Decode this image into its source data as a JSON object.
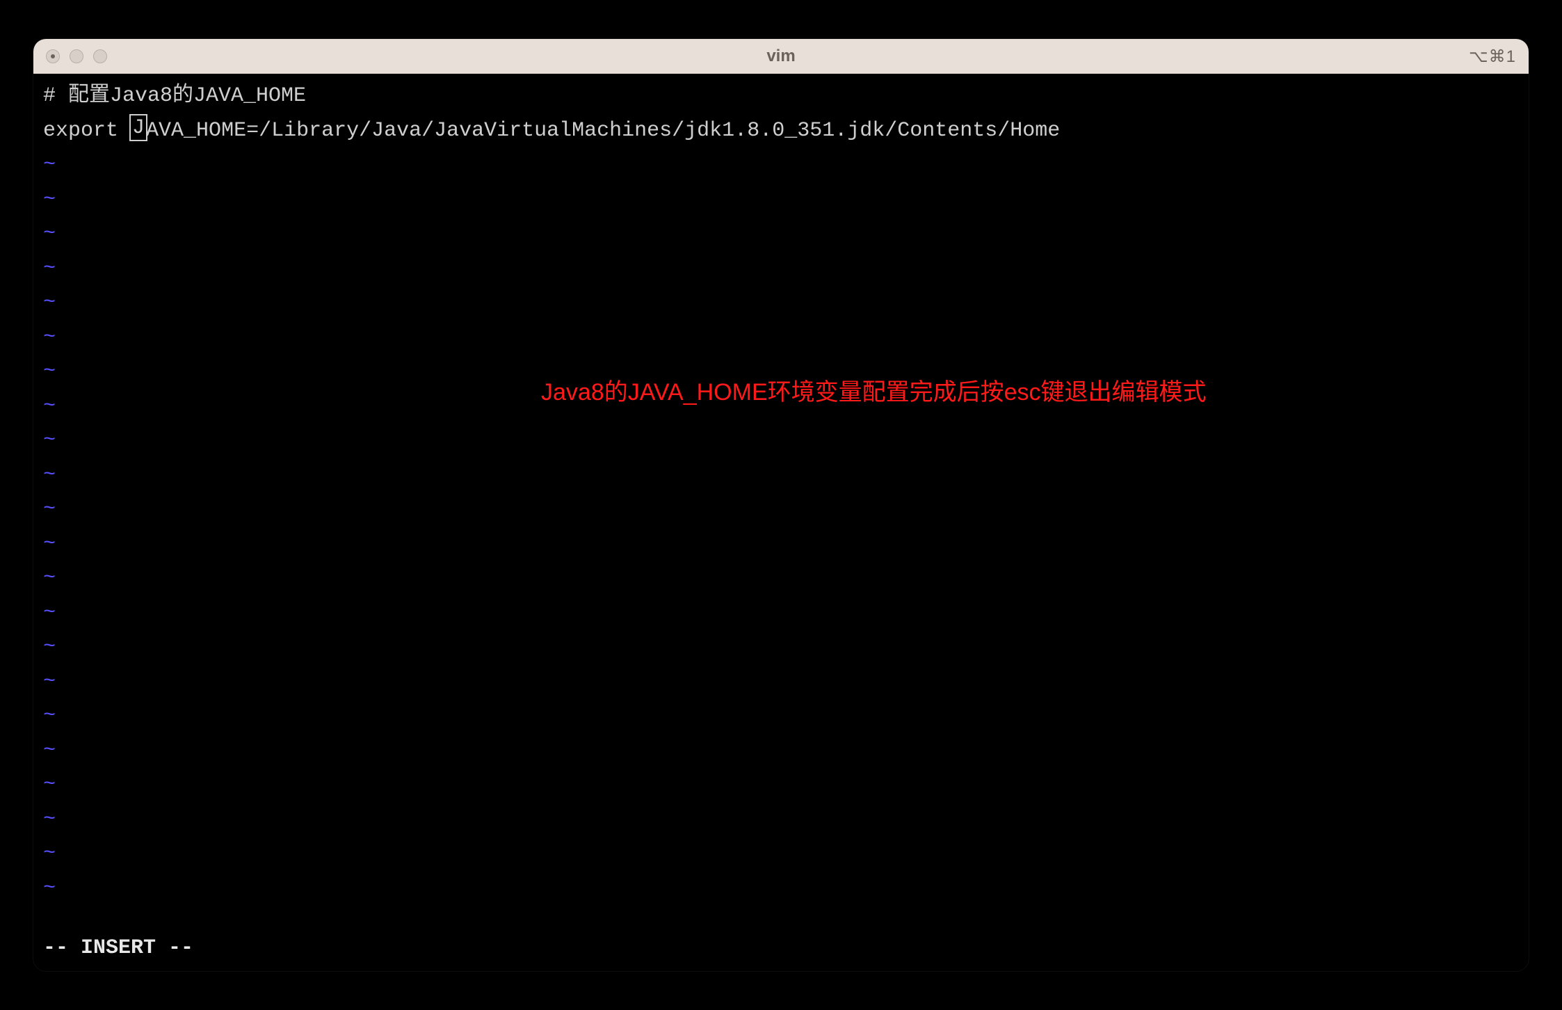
{
  "titlebar": {
    "title": "vim",
    "shortcut": "⌥⌘1"
  },
  "editor": {
    "line1": "# 配置Java8的JAVA_HOME",
    "line2_prefix": "export ",
    "line2_cursor_char": "J",
    "line2_rest": "AVA_HOME=/Library/Java/JavaVirtualMachines/jdk1.8.0_351.jdk/Contents/Home",
    "tilde": "~",
    "tilde_count": 22,
    "annotation": "Java8的JAVA_HOME环境变量配置完成后按esc键退出编辑模式",
    "status": "-- INSERT --"
  }
}
